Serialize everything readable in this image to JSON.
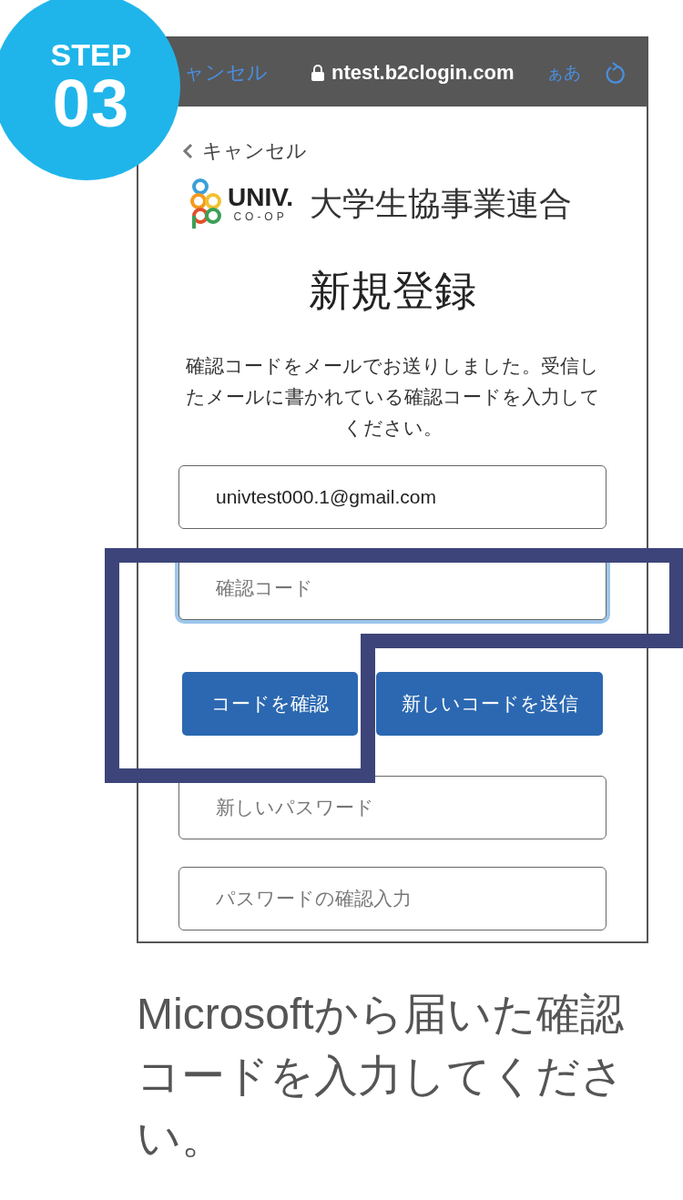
{
  "step": {
    "label": "STEP",
    "number": "03"
  },
  "browser_bar": {
    "back_text": "ャンセル",
    "url": "ntest.b2clogin.com",
    "text_size": "ぁあ"
  },
  "page": {
    "cancel": "キャンセル",
    "logo": {
      "wordmark": "UNIV.",
      "sub": "CO-OP",
      "org": "大学生協事業連合"
    },
    "title": "新規登録",
    "message": "確認コードをメールでお送りしました。受信したメールに書かれている確認コードを入力してください。",
    "fields": [
      {
        "kind": "value",
        "value": "univtest000.1@gmail.com",
        "focused": false
      },
      {
        "kind": "placeholder",
        "placeholder": "確認コード",
        "focused": true
      },
      {
        "kind": "placeholder",
        "placeholder": "新しいパスワード",
        "focused": false
      },
      {
        "kind": "placeholder",
        "placeholder": "パスワードの確認入力",
        "focused": false
      }
    ],
    "buttons": [
      "コードを確認",
      "新しいコードを送信"
    ]
  },
  "caption": "Microsoftから届いた確認コードを入力してください。"
}
